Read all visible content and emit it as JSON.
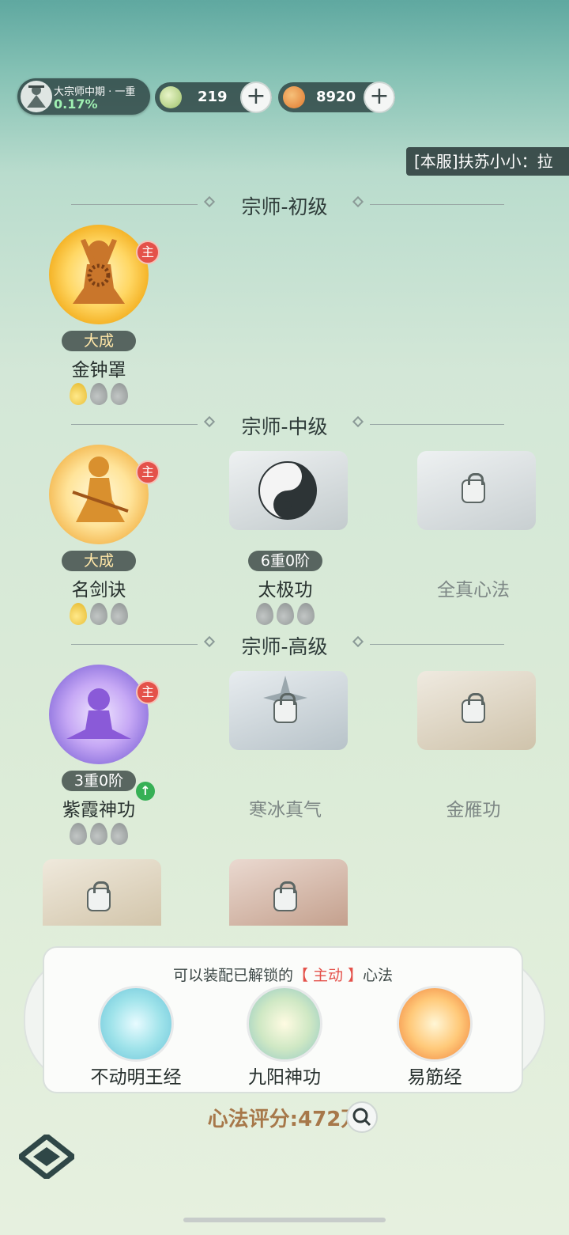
{
  "rank": {
    "title": "大宗师中期 · 一重",
    "percent": "0.17%"
  },
  "currency": [
    {
      "icon": "jade-drop-icon",
      "value": "219"
    },
    {
      "icon": "taiji-coin-icon",
      "value": "8920"
    }
  ],
  "broadcast": "[本服]扶苏小小：拉",
  "sections": [
    {
      "title": "宗师-初级"
    },
    {
      "title": "宗师-中级"
    },
    {
      "title": "宗师-高级"
    }
  ],
  "skills": {
    "jinzhongzhao": {
      "name": "金钟罩",
      "badge": "大成",
      "main": "主",
      "drops": [
        "gold",
        "grey",
        "grey"
      ]
    },
    "mingjianjue": {
      "name": "名剑诀",
      "badge": "大成",
      "main": "主",
      "drops": [
        "gold",
        "grey",
        "grey"
      ]
    },
    "taijigong": {
      "name": "太极功",
      "badge": "6重0阶",
      "drops": [
        "grey",
        "grey",
        "grey"
      ]
    },
    "quanzhen": {
      "name": "全真心法"
    },
    "zixia": {
      "name": "紫霞神功",
      "badge": "3重0阶",
      "main": "主",
      "drops": [
        "grey",
        "grey",
        "grey"
      ]
    },
    "hanbing": {
      "name": "寒冰真气"
    },
    "jinyan": {
      "name": "金雁功"
    }
  },
  "equip": {
    "prefix": "可以装配已解锁的",
    "highlight": "【 主动 】",
    "suffix": "心法",
    "slots": [
      {
        "name": "不动明王经"
      },
      {
        "name": "九阳神功"
      },
      {
        "name": "易筋经"
      }
    ]
  },
  "score": "心法评分:472万",
  "colors": {
    "accent_red": "#e4514a",
    "gold": "#e3b526",
    "score": "#a7784a"
  }
}
